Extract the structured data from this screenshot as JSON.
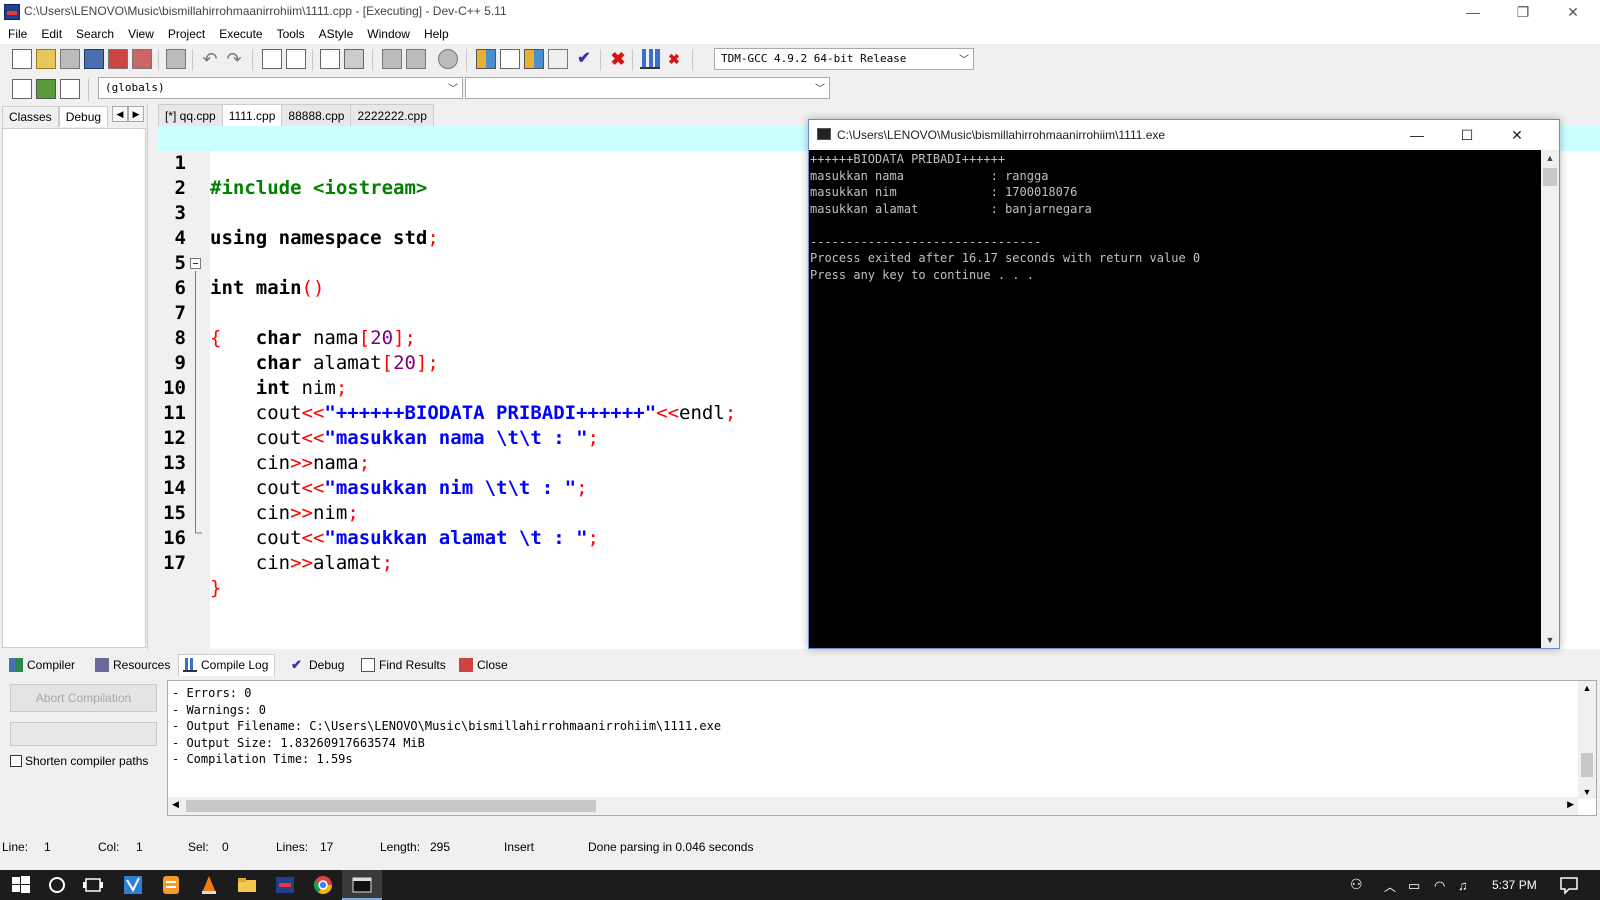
{
  "window": {
    "title": "C:\\Users\\LENOVO\\Music\\bismillahirrohmaanirrohiim\\1111.cpp - [Executing] - Dev-C++ 5.11",
    "minimize": "—",
    "restore": "❐",
    "close": "✕"
  },
  "menu": [
    "File",
    "Edit",
    "Search",
    "View",
    "Project",
    "Execute",
    "Tools",
    "AStyle",
    "Window",
    "Help"
  ],
  "toolbar": {
    "compiler_select": "TDM-GCC 4.9.2 64-bit Release",
    "scope_select": "(globals)",
    "function_select": ""
  },
  "left_panel": {
    "tabs": [
      "Classes",
      "Debug"
    ],
    "active_tab": "Debug"
  },
  "file_tabs": [
    "[*] qq.cpp",
    "1111.cpp",
    "88888.cpp",
    "2222222.cpp"
  ],
  "active_file": "1111.cpp",
  "code": {
    "line_numbers": [
      "1",
      "2",
      "3",
      "4",
      "5",
      "6",
      "7",
      "8",
      "9",
      "10",
      "11",
      "12",
      "13",
      "14",
      "15",
      "16",
      "17"
    ],
    "l1_pre": "#include <iostream>",
    "l3_kw": "using namespace",
    "l3_id": " std",
    "l3_sym": ";",
    "l5_kw": "int",
    "l5_id": " main",
    "l5_sym": "()",
    "l6_sym": "{",
    "l7_kw": "char",
    "l7_id": " nama",
    "l7_sym1": "[",
    "l7_num": "20",
    "l7_sym2": "];",
    "l8_kw": "char",
    "l8_id": " alamat",
    "l8_sym1": "[",
    "l8_num": "20",
    "l8_sym2": "];",
    "l9_kw": "int",
    "l9_id": " nim",
    "l9_sym": ";",
    "l10_id": "cout",
    "l10_sym1": "<<",
    "l10_str": "\"++++++BIODATA PRIBADI++++++\"",
    "l10_sym2": "<<",
    "l10_id2": "endl",
    "l10_sym3": ";",
    "l11_id": "cout",
    "l11_sym1": "<<",
    "l11_str": "\"masukkan nama \\t\\t : \"",
    "l11_sym2": ";",
    "l12_id": "cin",
    "l12_sym1": ">>",
    "l12_id2": "nama",
    "l12_sym2": ";",
    "l13_id": "cout",
    "l13_sym1": "<<",
    "l13_str": "\"masukkan nim \\t\\t : \"",
    "l13_sym2": ";",
    "l14_id": "cin",
    "l14_sym1": ">>",
    "l14_id2": "nim",
    "l14_sym2": ";",
    "l15_id": "cout",
    "l15_sym1": "<<",
    "l15_str": "\"masukkan alamat \\t : \"",
    "l15_sym2": ";",
    "l16_id": "cin",
    "l16_sym1": ">>",
    "l16_id2": "alamat",
    "l16_sym2": ";",
    "l17_sym": "}"
  },
  "console": {
    "title": "C:\\Users\\LENOVO\\Music\\bismillahirrohmaanirrohiim\\1111.exe",
    "output": "++++++BIODATA PRIBADI++++++\nmasukkan nama            : rangga\nmasukkan nim             : 1700018076\nmasukkan alamat          : banjarnegara\n\n--------------------------------\nProcess exited after 16.17 seconds with return value 0\nPress any key to continue . . ."
  },
  "bottom_tabs": [
    "Compiler",
    "Resources",
    "Compile Log",
    "Debug",
    "Find Results",
    "Close"
  ],
  "active_bottom_tab": "Compile Log",
  "compile_panel": {
    "abort_button": "Abort Compilation",
    "shorten_label": "Shorten compiler paths"
  },
  "compile_log": "- Errors: 0\n- Warnings: 0\n- Output Filename: C:\\Users\\LENOVO\\Music\\bismillahirrohmaanirrohiim\\1111.exe\n- Output Size: 1.83260917663574 MiB\n- Compilation Time: 1.59s",
  "status": {
    "line_label": "Line:",
    "line": "1",
    "col_label": "Col:",
    "col": "1",
    "sel_label": "Sel:",
    "sel": "0",
    "lines_label": "Lines:",
    "lines": "17",
    "length_label": "Length:",
    "length": "295",
    "mode": "Insert",
    "message": "Done parsing in 0.046 seconds"
  },
  "taskbar": {
    "clock": "5:37 PM",
    "icons": [
      "windows-start-icon",
      "cortana-icon",
      "task-view-icon",
      "visual-studio-icon",
      "sublime-icon",
      "vlc-icon",
      "file-explorer-icon",
      "devcpp-icon",
      "chrome-icon",
      "console-icon"
    ]
  }
}
